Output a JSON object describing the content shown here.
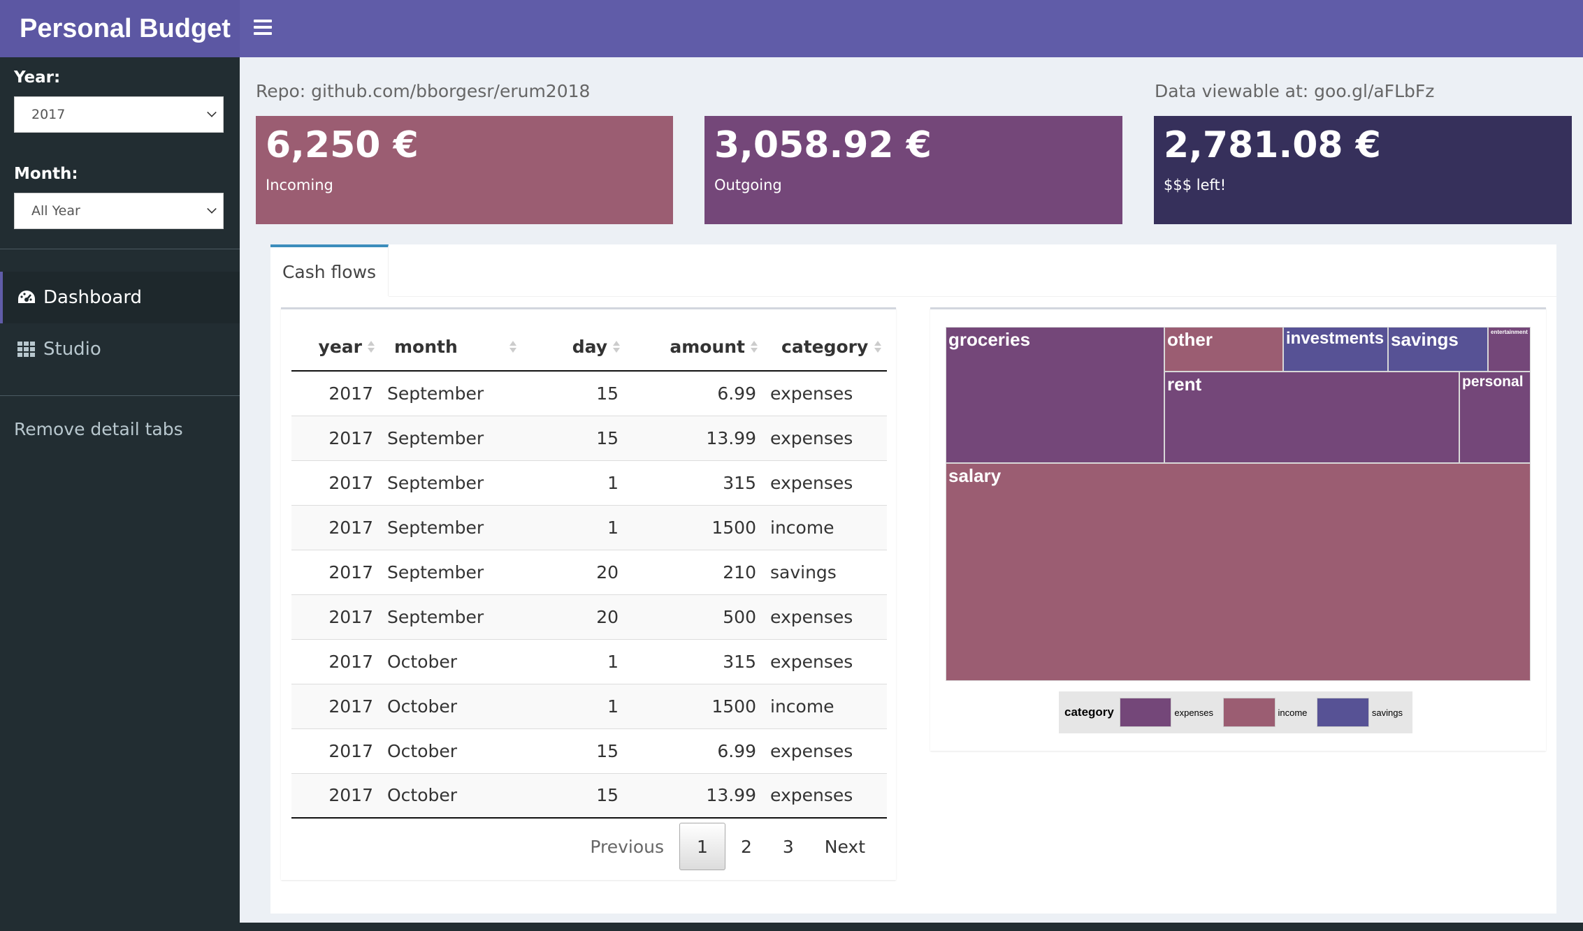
{
  "app": {
    "title": "Personal Budget"
  },
  "sidebar": {
    "year_label": "Year:",
    "year_value": "2017",
    "month_label": "Month:",
    "month_value": "All Year",
    "menu": [
      {
        "label": "Dashboard",
        "icon": "dashboard-icon",
        "active": true
      },
      {
        "label": "Studio",
        "icon": "grid-icon",
        "active": false
      }
    ],
    "remove_tabs": "Remove detail tabs"
  },
  "content": {
    "repo_text": "Repo: github.com/bborgesr/erum2018",
    "data_text": "Data viewable at: goo.gl/aFLbFz",
    "value_boxes": [
      {
        "value": "6,250 €",
        "label": "Incoming",
        "color": "#9b5d72"
      },
      {
        "value": "3,058.92 €",
        "label": "Outgoing",
        "color": "#744779"
      },
      {
        "value": "2,781.08 €",
        "label": "$$$ left!",
        "color": "#36305b"
      }
    ],
    "tab_label": "Cash flows"
  },
  "table": {
    "headers": [
      "year",
      "month",
      "day",
      "amount",
      "category"
    ],
    "rows": [
      [
        "2017",
        "September",
        "15",
        "6.99",
        "expenses"
      ],
      [
        "2017",
        "September",
        "15",
        "13.99",
        "expenses"
      ],
      [
        "2017",
        "September",
        "1",
        "315",
        "expenses"
      ],
      [
        "2017",
        "September",
        "1",
        "1500",
        "income"
      ],
      [
        "2017",
        "September",
        "20",
        "210",
        "savings"
      ],
      [
        "2017",
        "September",
        "20",
        "500",
        "expenses"
      ],
      [
        "2017",
        "October",
        "1",
        "315",
        "expenses"
      ],
      [
        "2017",
        "October",
        "1",
        "1500",
        "income"
      ],
      [
        "2017",
        "October",
        "15",
        "6.99",
        "expenses"
      ],
      [
        "2017",
        "October",
        "15",
        "13.99",
        "expenses"
      ]
    ],
    "pagination": {
      "previous": "Previous",
      "pages": [
        "1",
        "2",
        "3"
      ],
      "current": "1",
      "next": "Next"
    }
  },
  "treemap": {
    "colors": {
      "expenses": "#744779",
      "income": "#9b5d72",
      "savings": "#575295"
    },
    "cells": [
      {
        "label": "groceries",
        "category": "expenses"
      },
      {
        "label": "other",
        "category": "income"
      },
      {
        "label": "investments",
        "category": "savings"
      },
      {
        "label": "savings",
        "category": "savings"
      },
      {
        "label": "entertainment",
        "category": "expenses"
      },
      {
        "label": "rent",
        "category": "expenses"
      },
      {
        "label": "personal",
        "category": "expenses"
      },
      {
        "label": "salary",
        "category": "income"
      }
    ],
    "legend": {
      "title": "category",
      "items": [
        {
          "label": "expenses",
          "category": "expenses"
        },
        {
          "label": "income",
          "category": "income"
        },
        {
          "label": "savings",
          "category": "savings"
        }
      ]
    }
  }
}
